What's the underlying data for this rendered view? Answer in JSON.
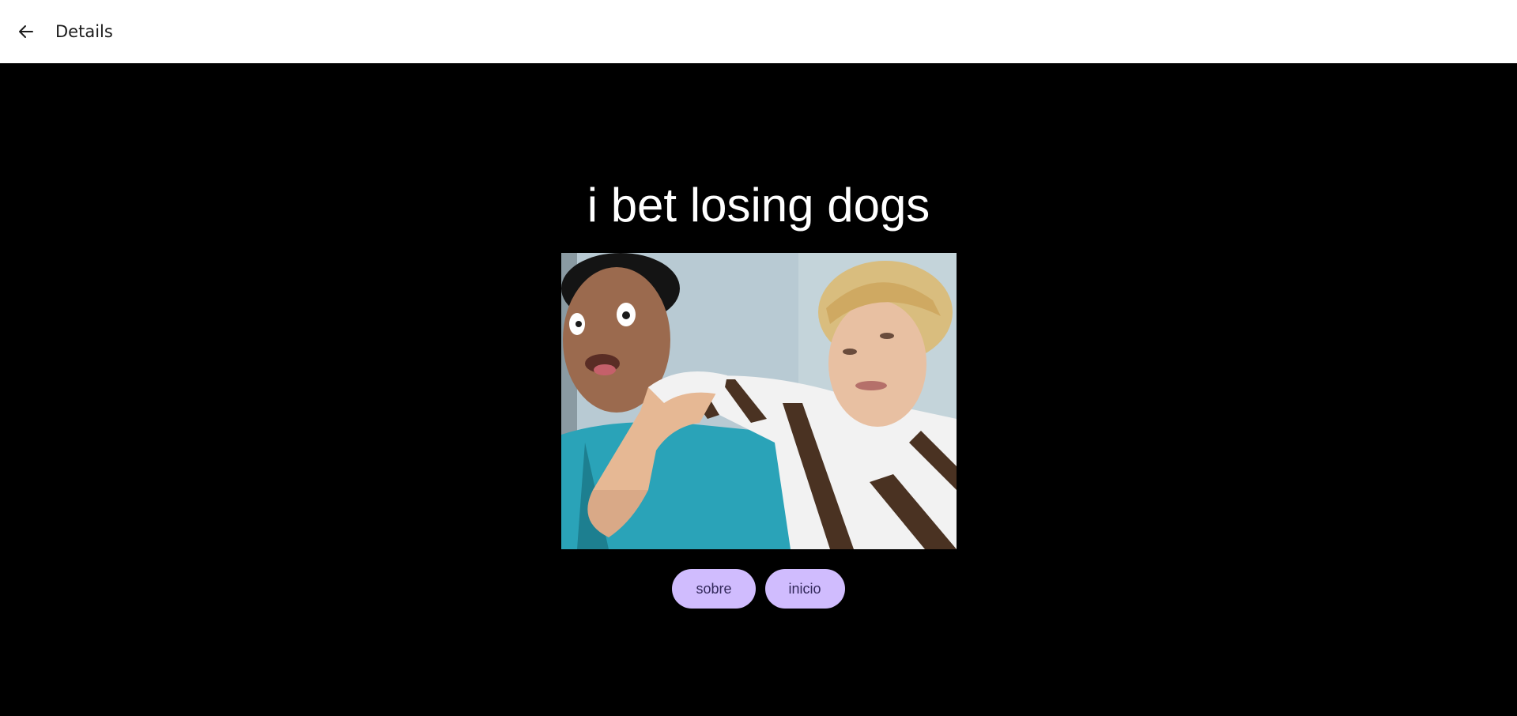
{
  "app_bar": {
    "back_icon": "arrow-left-icon",
    "title": "Details"
  },
  "main": {
    "headline": "i bet losing dogs",
    "image_alt": "",
    "buttons": [
      {
        "label": "sobre"
      },
      {
        "label": "inicio"
      }
    ]
  },
  "colors": {
    "background": "#000000",
    "app_bar": "#ffffff",
    "button_bg": "#d0bcfe",
    "button_text": "#32285a",
    "headline": "#ffffff"
  }
}
